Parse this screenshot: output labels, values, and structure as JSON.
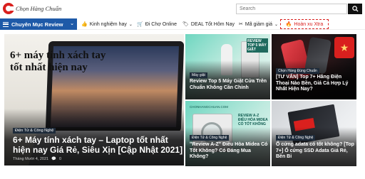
{
  "header": {
    "logo_text": "Chọn Hàng Chuẩn",
    "search_placeholder": "Search"
  },
  "nav": {
    "category_label": "Chuyên Mục Review",
    "items": [
      {
        "label": "Kinh nghiệm hay",
        "icon": "thumbs-up-icon",
        "has_dropdown": true
      },
      {
        "label": "Đi Chợ Online",
        "icon": "cart-icon",
        "has_dropdown": false
      },
      {
        "label": "DEAL Tốt Hôm Nay",
        "icon": "tag-icon",
        "has_dropdown": false
      },
      {
        "label": "Mã giảm giá",
        "icon": "percent-icon",
        "has_dropdown": true
      }
    ],
    "hot_label": "Hoàn xu Xtra"
  },
  "featured": {
    "overlay_text": "6+ máy tính xách tay tốt nhất hiện nay",
    "category": "Điện Tử & Công Nghệ",
    "title": "6+ Máy tính xách tay – Laptop tốt nhất hiện nay Giá Rẻ, Siêu Xịn [Cập Nhật 2021]",
    "date": "Tháng Mười 4, 2021",
    "comments": "0"
  },
  "cards": [
    {
      "category": "Máy giặt",
      "title": "Review Top 5 Máy Giặt Cửa Trên Chuẩn Không Cần Chỉnh",
      "badge": "REVIEW TOP 5 MÁY GIẶT"
    },
    {
      "category": "Chọn Hàng Đúng Chuẩn",
      "title": "[TƯ VẤN] Top 7+ Hãng Điện Thoại Nào Bền, Giá Cả Hợp Lý Nhất Hiện Nay?"
    },
    {
      "category": "Điện Tử & Công Nghệ",
      "title": "\"Review A-Z\" Điều Hòa Midea Có Tốt Không? Có Đáng Mua Không?",
      "badge": "REVIEW A-Z ĐIỀU HÒA MIDEA CÓ TỐT KHÔNG",
      "site": "CHONHANGCHUAN.COM"
    },
    {
      "category": "Điện Tử & Công Nghệ",
      "title": "Ổ cứng adata có tốt không? [Top 7+] Ổ cứng SSD Adata Giá Rẻ, Bền Bỉ"
    }
  ]
}
